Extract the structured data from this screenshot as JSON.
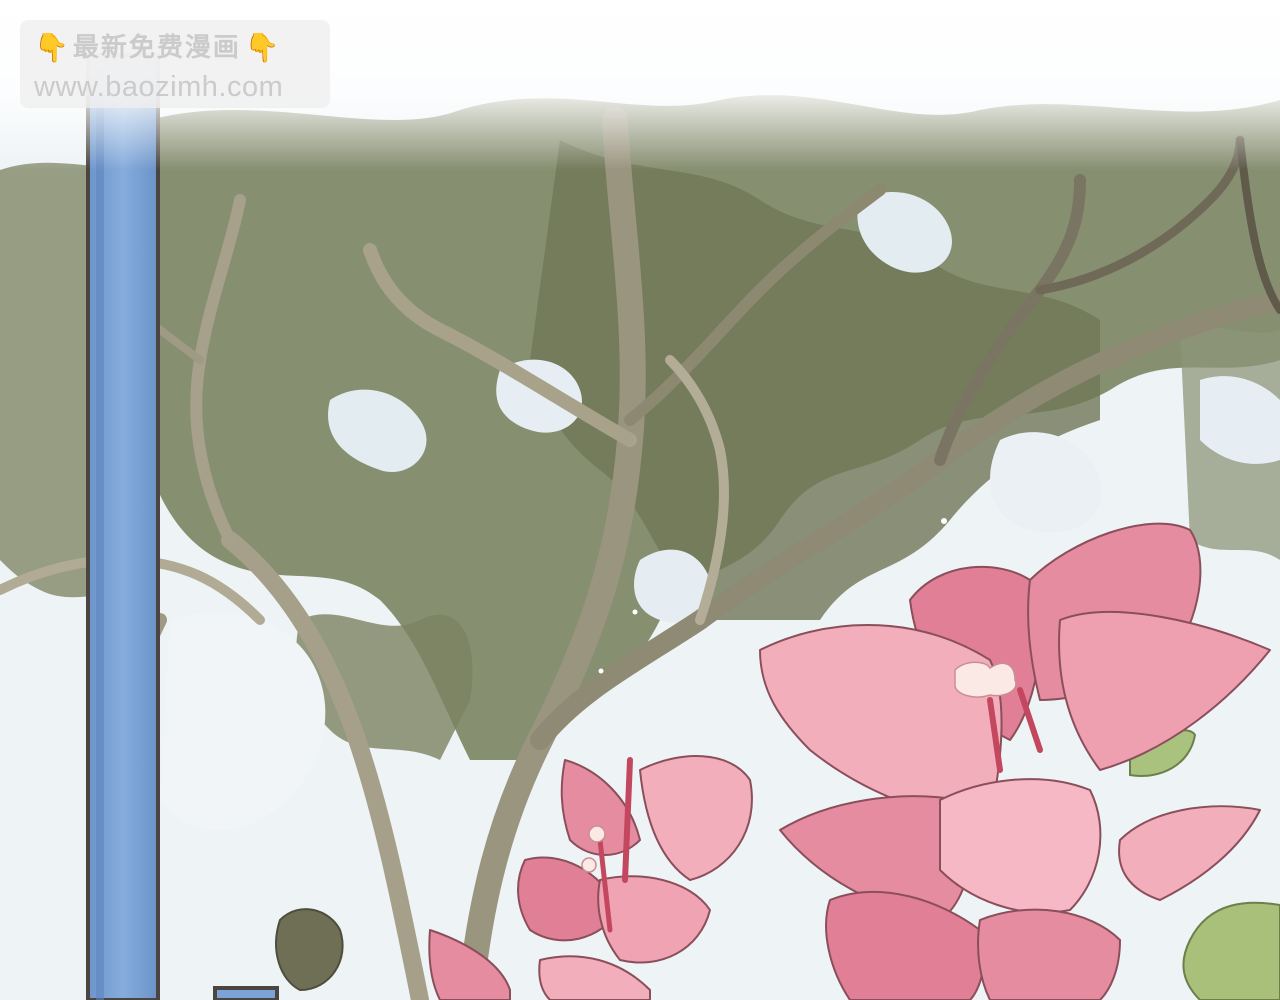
{
  "watermark": {
    "title": "最新免费漫画",
    "url": "www.baozimh.com",
    "icon_left": "pointing-down-hand-icon",
    "icon_right": "pointing-down-hand-icon"
  },
  "colors": {
    "sky": "#eef3f6",
    "foliage": "#7e8765",
    "foliage_dark": "#5a6048",
    "bark": "#a29d88",
    "pillar": "#7ba3d6",
    "pillar_border": "#4a4540",
    "petal": "#e8909f",
    "petal_light": "#f4b3bd",
    "leaf": "#a8c07a"
  }
}
